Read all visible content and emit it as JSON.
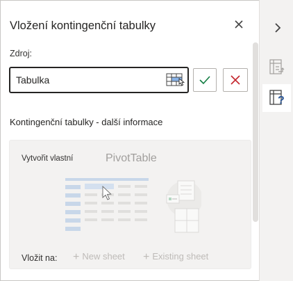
{
  "pane": {
    "title": "Vložení kontingenční tabulky",
    "source_label": "Zdroj:",
    "source_value": "Tabulka",
    "more_info_heading": "Kontingenční tabulky - další informace"
  },
  "card": {
    "create_label": "Vytvořit vlastní",
    "pivot_label": "PivotTable",
    "insert_label": "Vložit na:",
    "new_sheet_label": "New sheet",
    "existing_sheet_label": "Existing sheet"
  },
  "icons": {
    "close": "close-icon",
    "range_picker": "table-select-icon",
    "confirm": "checkmark-icon",
    "cancel": "x-icon",
    "collapse": "chevron-right-icon",
    "rail_1": "pivot-layout-icon",
    "rail_2": "pivot-help-icon"
  },
  "colors": {
    "accent_green": "#107c41",
    "cancel_red": "#c4262e",
    "disabled_text": "#bebbb8",
    "illustration_blue": "#a6c1e4"
  }
}
